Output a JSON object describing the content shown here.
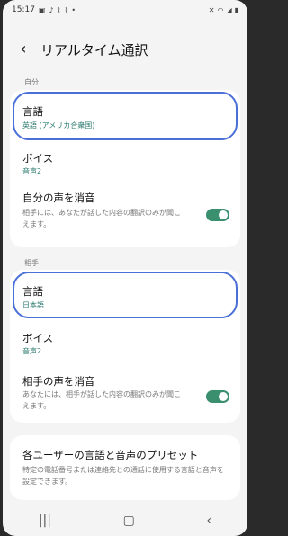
{
  "status_bar": {
    "time": "15:17",
    "icons_left": [
      "gallery-icon",
      "bell-icon",
      "clip-icon",
      "clip-icon",
      "dot"
    ],
    "icons_right": [
      "mute-icon",
      "wifi-icon",
      "signal-icon",
      "battery-icon"
    ]
  },
  "header": {
    "back_label": "<",
    "title": "リアルタイム通訳"
  },
  "sections": {
    "self": {
      "label": "自分",
      "language": {
        "label": "言語",
        "value": "英語 (アメリカ合衆国)"
      },
      "voice": {
        "label": "ボイス",
        "value": "音声2"
      },
      "mute": {
        "label": "自分の声を消音",
        "desc": "相手には、あなたが話した内容の翻訳のみが聞こえます。",
        "on": true
      }
    },
    "other": {
      "label": "相手",
      "language": {
        "label": "言語",
        "value": "日本語"
      },
      "voice": {
        "label": "ボイス",
        "value": "音声2"
      },
      "mute": {
        "label": "相手の声を消音",
        "desc": "あなたには、相手が話した内容の翻訳のみが聞こえます。",
        "on": true
      }
    }
  },
  "preset": {
    "label": "各ユーザーの言語と音声のプリセット",
    "desc": "特定の電話番号または連絡先との通話に使用する言語と音声を設定できます。"
  },
  "colors": {
    "accent": "#3a8f6f",
    "highlight": "#4a6fd6",
    "value_text": "#2a7a6e"
  }
}
